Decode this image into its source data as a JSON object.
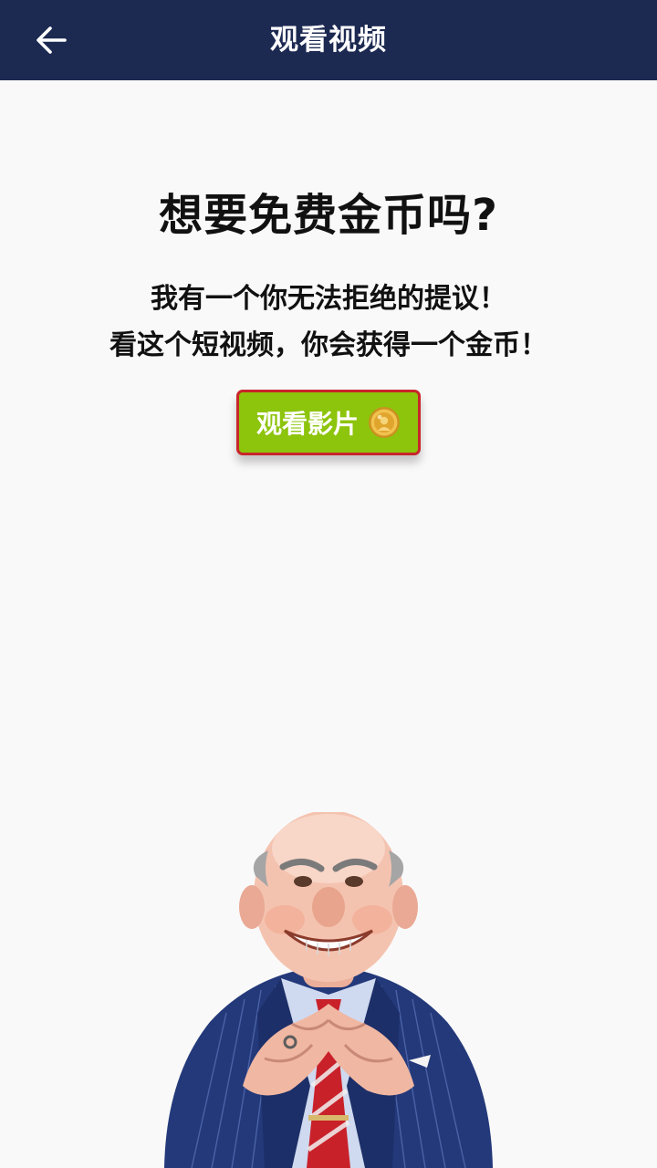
{
  "appbar": {
    "title": "观看视频",
    "back_icon": "arrow-left-icon",
    "background": "#1c2951"
  },
  "main": {
    "headline": "想要免费金币吗?",
    "line1": "我有一个你无法拒绝的提议！",
    "line2": "看这个短视频，你会获得一个金币！"
  },
  "watch_button": {
    "label": "观看影片",
    "icon": "coin-icon",
    "background": "#8dc40c",
    "border": "#c9262a"
  },
  "mascot": {
    "icon": "businessman-mascot-illustration"
  }
}
